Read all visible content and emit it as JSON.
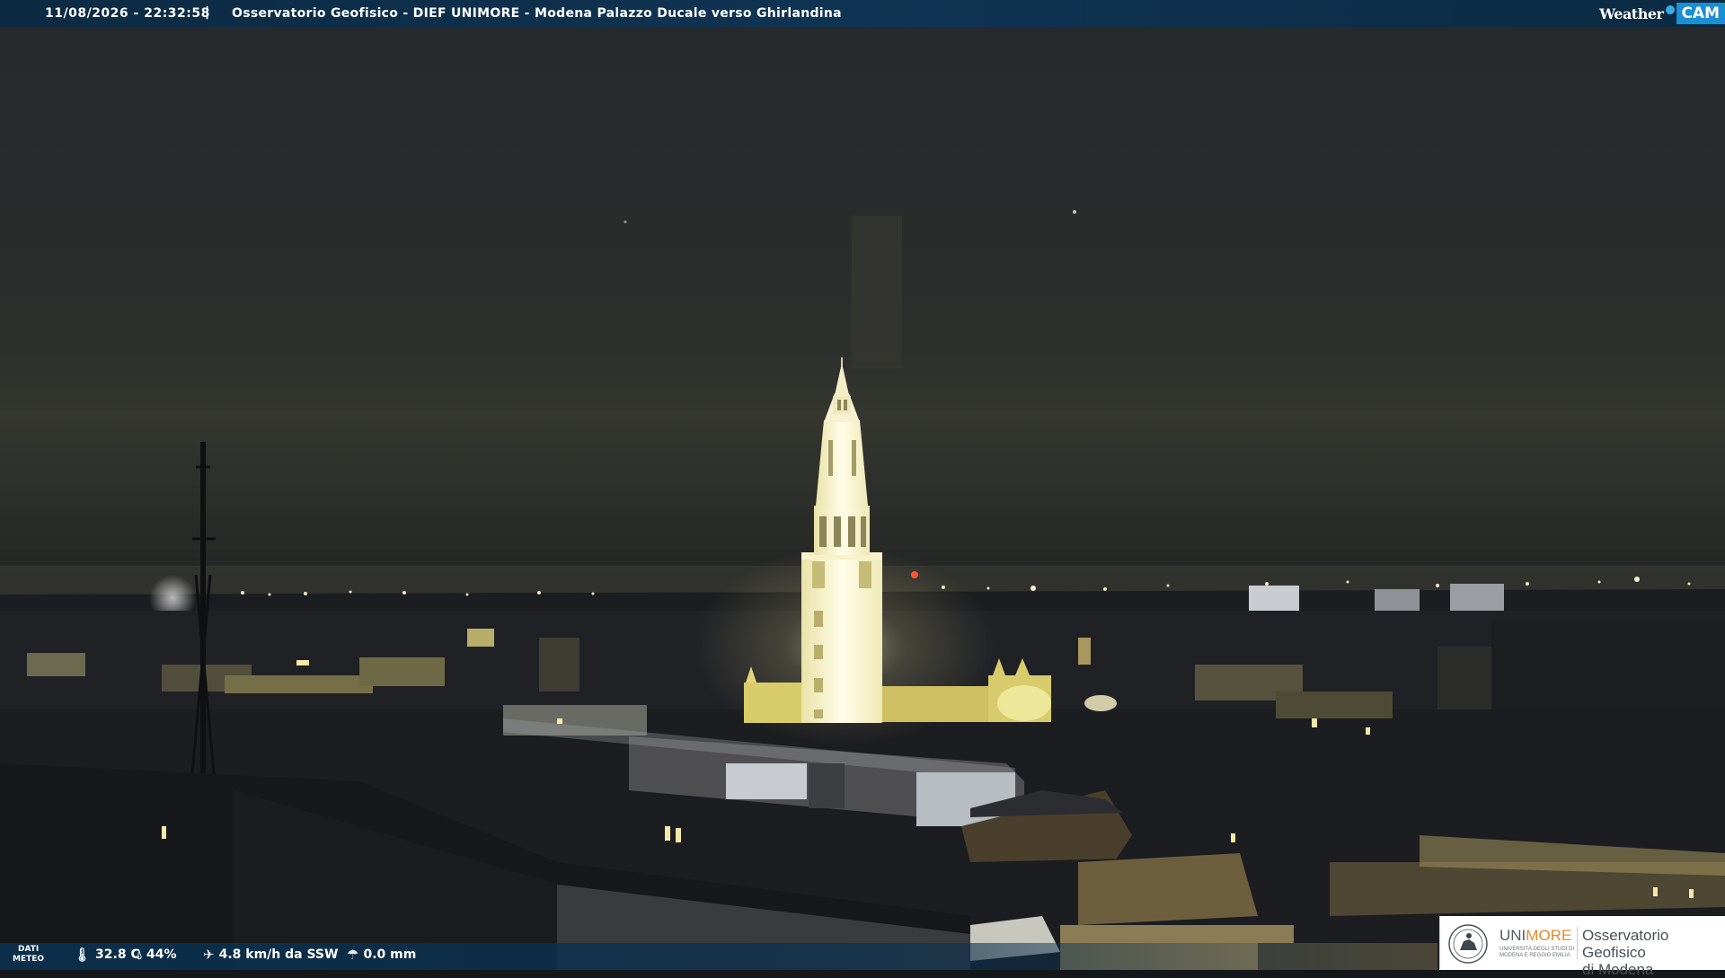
{
  "header": {
    "timestamp": "11/08/2026 - 22:32:58",
    "separator": "|",
    "title": "Osservatorio Geofisico - DIEF UNIMORE - Modena Palazzo Ducale verso Ghirlandina",
    "brand_weather": "Weather",
    "brand_cam": "CAM"
  },
  "footer": {
    "dati_line1": "DATI",
    "dati_line2": "METEO",
    "temperature": "32.8 C",
    "humidity": "44%",
    "wind": "4.8 km/h da SSW",
    "rain": "0.0 mm",
    "icons": [
      "thermometer-icon",
      "humidity-drop-icon",
      "wind-icon",
      "rain-gauge-icon"
    ]
  },
  "logo": {
    "uni": "UNI",
    "more": "MORE",
    "university_line1": "UNIVERSITÀ DEGLI STUDI DI",
    "university_line2": "MODENA E REGGIO EMILIA",
    "observatory_line1": "Osservatorio Geofisico",
    "observatory_line2": "di Modena"
  },
  "colors": {
    "bar": "#0f3453",
    "tower_light": "#fffbe0",
    "sky": "#2b2d29",
    "accent_orange": "#e58a2b",
    "weathercam_blue": "#1b8fd3"
  }
}
